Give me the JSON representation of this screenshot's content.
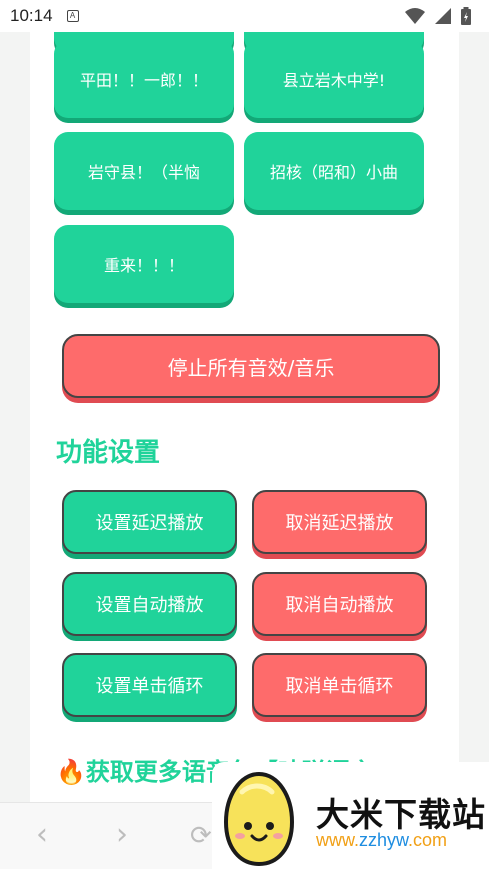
{
  "status": {
    "time": "10:14",
    "badge": "A"
  },
  "sounds": [
    {
      "label": "平田！！一郎！！"
    },
    {
      "label": "县立岩木中学!"
    },
    {
      "label": "岩守县！（半恼"
    },
    {
      "label": "招核（昭和）小曲"
    },
    {
      "label": "重来！！！"
    }
  ],
  "stop_all_label": "停止所有音效/音乐",
  "settings": {
    "title": "功能设置",
    "set_delay": "设置延迟播放",
    "cancel_delay": "取消延迟播放",
    "set_auto": "设置自动播放",
    "cancel_auto": "取消自动播放",
    "set_loop": "设置单击循环",
    "cancel_loop": "取消单击循环"
  },
  "more": {
    "title": "🔥获取更多语音包【吵弹语言"
  },
  "watermark": {
    "brand": "大米下载站",
    "url_a": "www.",
    "url_b": "zzhyw",
    "url_c": ".com"
  },
  "colors": {
    "green": "#20d39a",
    "red": "#fe6b6b",
    "border": "#444444"
  },
  "icons": {
    "back": "chevron-left-icon",
    "forward": "chevron-right-icon",
    "refresh": "refresh-icon",
    "wifi": "wifi-icon",
    "signal": "signal-icon",
    "battery": "battery-icon"
  }
}
